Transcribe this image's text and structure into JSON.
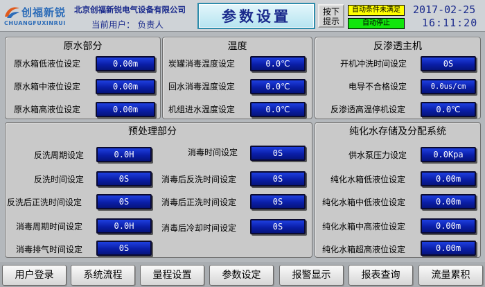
{
  "header": {
    "logo_cn": "创福新锐",
    "logo_en": "CHUANGFUXINRUI",
    "company": "北京创福新锐电气设备有限公司",
    "user_label": "当前用户：",
    "user_value": "负责人",
    "title": "参数设置",
    "press_button": [
      "按下",
      "提示"
    ],
    "status_condition": "自动条件未满足",
    "status_auto": "自动停止",
    "date": "2017-02-25",
    "time": "16:11:20",
    "colors": {
      "status_condition": "#ffff00",
      "status_auto": "#12e60c",
      "title_border": "#2e8cab"
    }
  },
  "panels": {
    "raw_water": {
      "title": "原水部分",
      "rows": [
        {
          "label": "原水箱低液位设定",
          "value": "0.00m"
        },
        {
          "label": "原水箱中液位设定",
          "value": "0.00m"
        },
        {
          "label": "原水箱高液位设定",
          "value": "0.00m"
        }
      ]
    },
    "temperature": {
      "title": "温度",
      "rows": [
        {
          "label": "炭罐消毒温度设定",
          "value": "0.0℃"
        },
        {
          "label": "回水消毒温度设定",
          "value": "0.0℃"
        },
        {
          "label": "机组进水温度设定",
          "value": "0.0℃"
        }
      ]
    },
    "ro_main": {
      "title": "反渗透主机",
      "rows": [
        {
          "label": "开机冲洗时间设定",
          "value": "0S"
        },
        {
          "label": "电导不合格设定",
          "value": "0.0us/cm"
        },
        {
          "label": "反渗透高温停机设定",
          "value": "0.0℃"
        }
      ]
    },
    "pretreatment": {
      "title": "预处理部分",
      "left_rows": [
        {
          "label": "反洗周期设定",
          "value": "0.0H"
        },
        {
          "label": "反洗时间设定",
          "value": "0S"
        },
        {
          "label": "反洗后正洗时间设定",
          "value": "0S"
        },
        {
          "label": "消毒周期时间设定",
          "value": "0.0H"
        },
        {
          "label": "消毒排气时间设定",
          "value": "0S"
        }
      ],
      "right_rows": [
        {
          "label": "消毒时间设定",
          "value": "0S"
        },
        {
          "label": "消毒后反洗时间设定",
          "value": "0S"
        },
        {
          "label": "消毒后正洗时间设定",
          "value": "0S"
        },
        {
          "label": "消毒后冷却时间设定",
          "value": "0S"
        }
      ]
    },
    "storage": {
      "title": "纯化水存储及分配系统",
      "rows": [
        {
          "label": "供水泵压力设定",
          "value": "0.0Kpa"
        },
        {
          "label": "纯化水箱低液位设定",
          "value": "0.00m"
        },
        {
          "label": "纯化水箱中低液位设定",
          "value": "0.00m"
        },
        {
          "label": "纯化水箱中高液位设定",
          "value": "0.00m"
        },
        {
          "label": "纯化水箱超高液位设定",
          "value": "0.00m"
        }
      ]
    }
  },
  "nav": [
    "用户登录",
    "系统流程",
    "量程设置",
    "参数设定",
    "报警显示",
    "报表查询",
    "流量累积"
  ],
  "colors": {
    "value_box": "#0a1ea8",
    "panel_bg": "#c9c9c9"
  }
}
